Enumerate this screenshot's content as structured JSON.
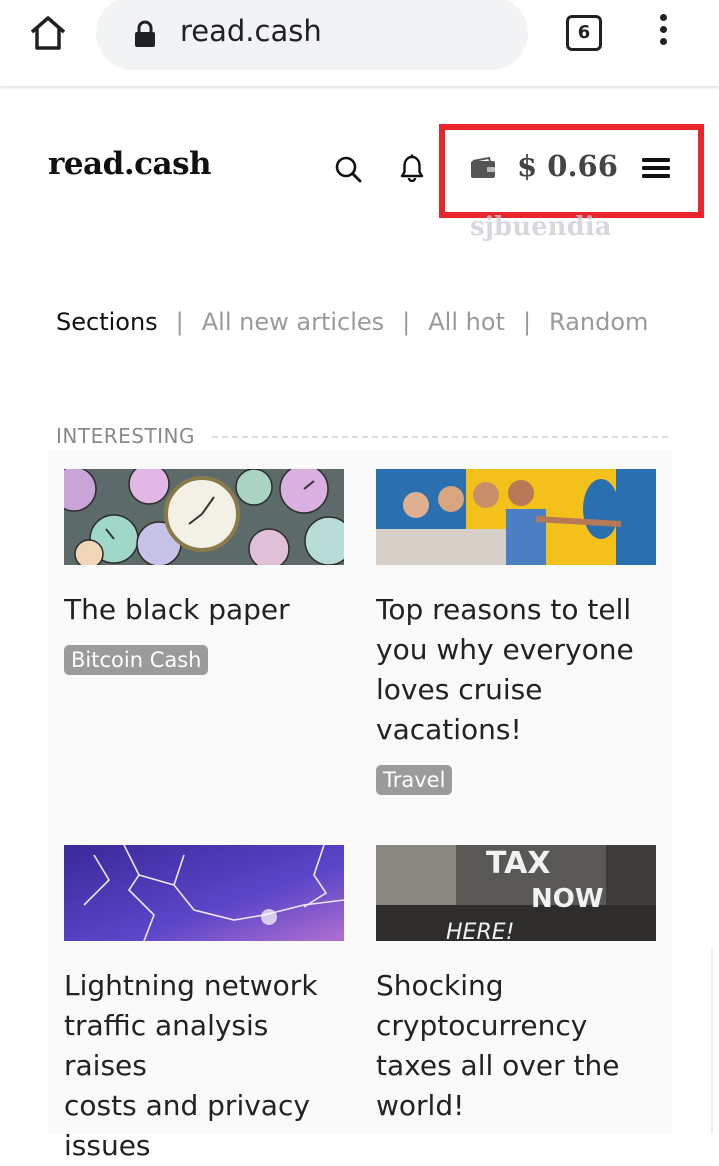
{
  "browser": {
    "url": "read.cash",
    "tab_count": "6",
    "icons": [
      "home-icon",
      "lock-icon",
      "tabs-icon",
      "more-vert-icon"
    ]
  },
  "header": {
    "logo": "read.cash",
    "balance": "$ 0.66",
    "watermark": "sjbuendia",
    "highlight_color": "#e8262c",
    "icons": [
      "search-icon",
      "bell-icon",
      "wallet-icon",
      "menu-icon"
    ]
  },
  "nav": {
    "items": [
      {
        "label": "Sections"
      },
      {
        "label": "All new articles"
      },
      {
        "label": "All hot"
      },
      {
        "label": "Random"
      }
    ],
    "separator": "|"
  },
  "section": {
    "label": "INTERESTING"
  },
  "articles": [
    {
      "title_lines": [
        "The black paper"
      ],
      "tag": "Bitcoin Cash",
      "image": "clocks-image"
    },
    {
      "title_lines": [
        "Top reasons to tell",
        "you why everyone",
        "loves cruise",
        "vacations!"
      ],
      "tag": "Travel",
      "image": "cruise-image"
    },
    {
      "title_lines": [
        "Lightning network",
        "traffic analysis raises",
        "costs and privacy",
        "issues"
      ],
      "image": "lightning-image"
    },
    {
      "title_lines": [
        "Shocking",
        "cryptocurrency",
        "taxes all over the",
        "world!"
      ],
      "image": "tax-image",
      "image_text": [
        "TAX",
        "NOW",
        "HERE!"
      ]
    }
  ]
}
